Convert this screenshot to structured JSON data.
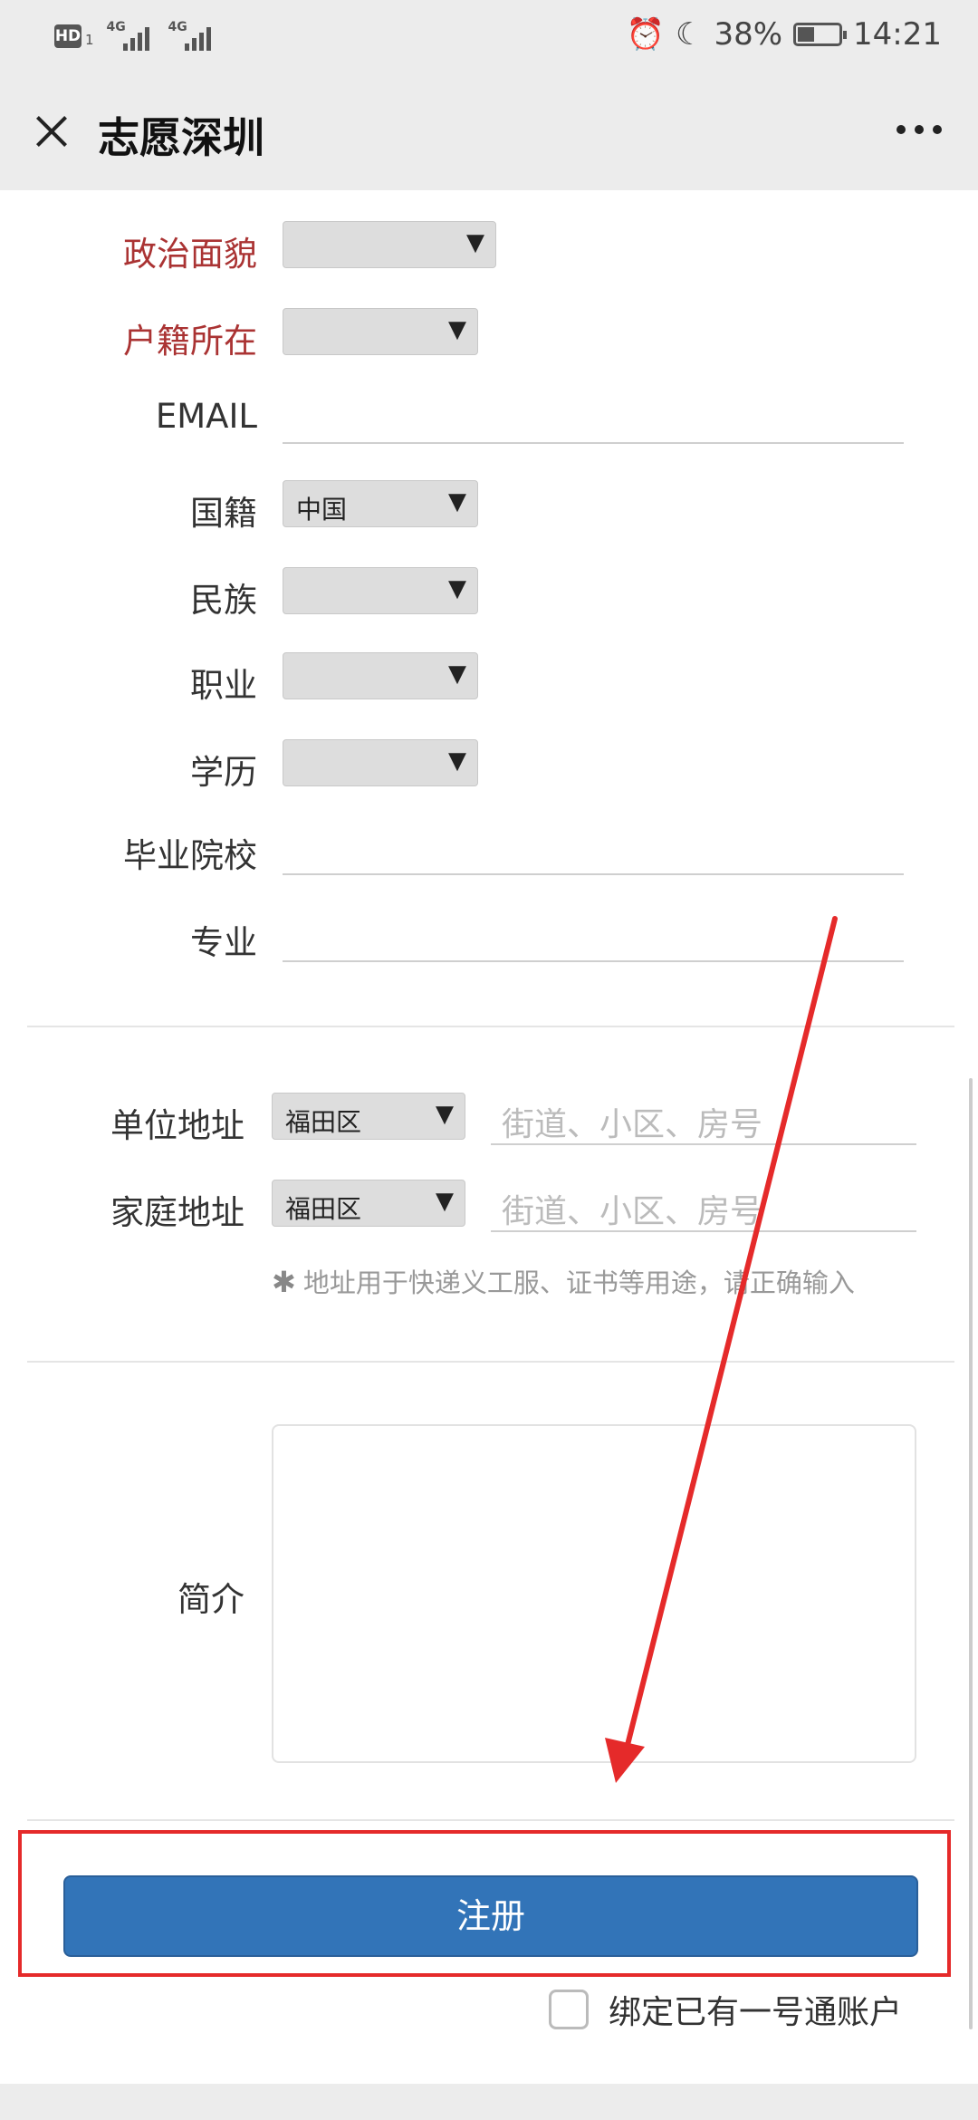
{
  "status_bar": {
    "hd": "HD",
    "sim": "1",
    "net1": "4G",
    "net2": "4G",
    "battery": "38%",
    "time": "14:21"
  },
  "header": {
    "title": "志愿深圳"
  },
  "form": {
    "political": {
      "label": "政治面貌",
      "value": ""
    },
    "household": {
      "label": "户籍所在",
      "value": ""
    },
    "email": {
      "label": "EMAIL",
      "value": ""
    },
    "nationality": {
      "label": "国籍",
      "value": "中国"
    },
    "ethnicity": {
      "label": "民族",
      "value": ""
    },
    "occupation": {
      "label": "职业",
      "value": ""
    },
    "education": {
      "label": "学历",
      "value": ""
    },
    "school": {
      "label": "毕业院校",
      "value": ""
    },
    "major": {
      "label": "专业",
      "value": ""
    },
    "work_address": {
      "label": "单位地址",
      "district": "福田区",
      "placeholder": "街道、小区、房号"
    },
    "home_address": {
      "label": "家庭地址",
      "district": "福田区",
      "placeholder": "街道、小区、房号"
    },
    "address_note": "地址用于快递义工服、证书等用途，请正确输入",
    "intro": {
      "label": "简介",
      "value": ""
    },
    "register_label": "注册",
    "bind_label": "绑定已有一号通账户"
  },
  "colors": {
    "required_label": "#a33333",
    "button": "#3274b8",
    "annotation": "#e52a2a"
  }
}
